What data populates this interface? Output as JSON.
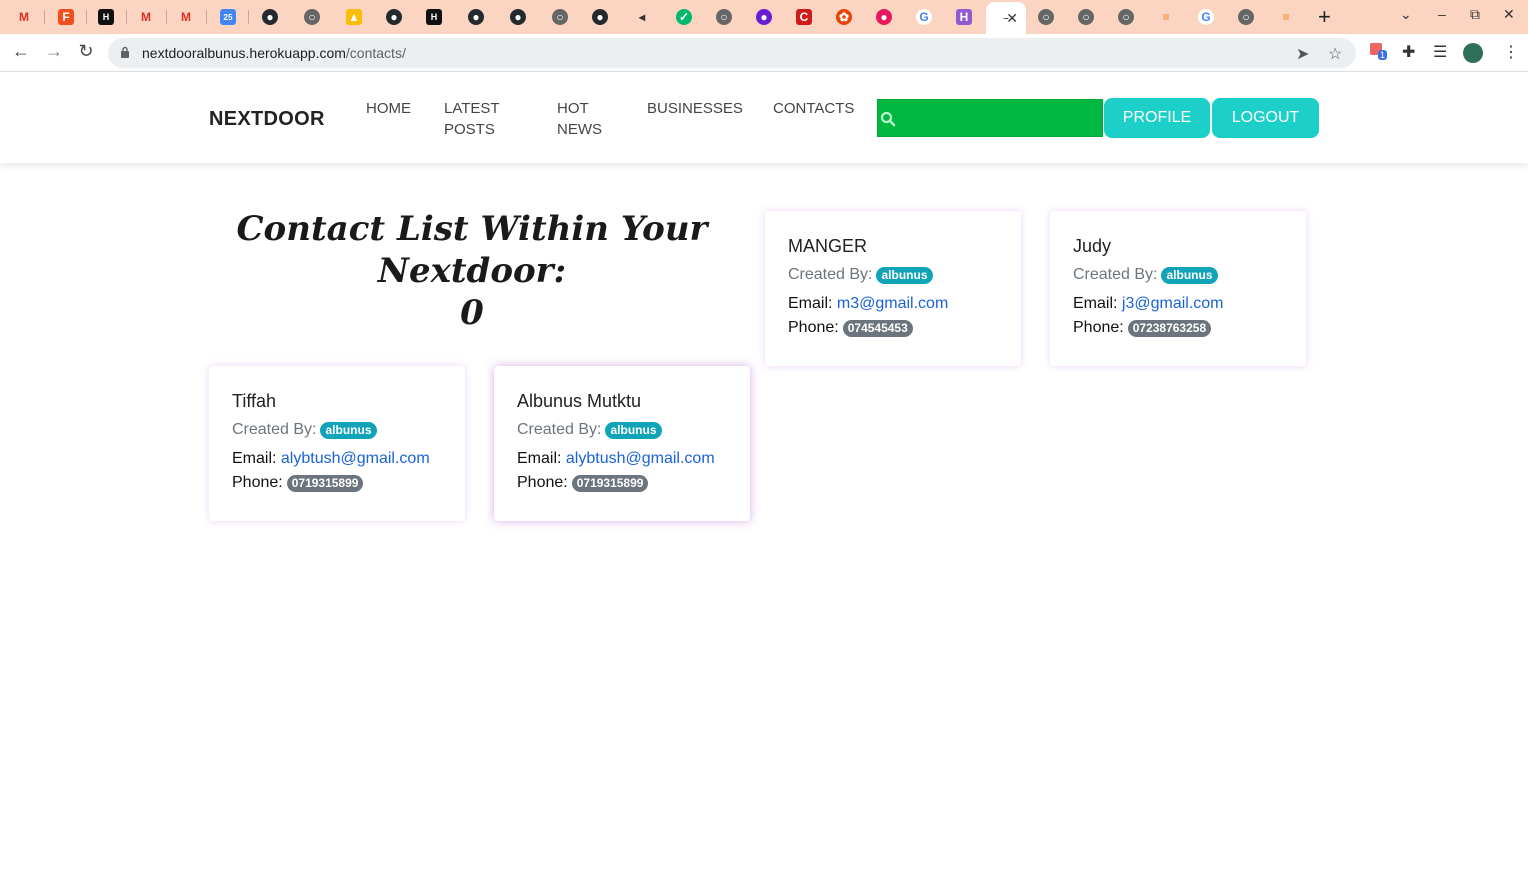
{
  "browser": {
    "url_host": "nextdooralbunus.herokuapp.com",
    "url_path": "/contacts/",
    "extension_badge": "1"
  },
  "site": {
    "brand": "NEXTDOOR",
    "nav": {
      "home": "HOME",
      "latest_posts_1": "LATEST",
      "latest_posts_2": "POSTS",
      "hot_news_1": "HOT",
      "hot_news_2": "NEWS",
      "businesses": "BUSINESSES",
      "contacts": "CONTACTS"
    },
    "search": {
      "value": "",
      "placeholder": ""
    },
    "profile_label": "PROFILE",
    "logout_label": "LOGOUT"
  },
  "page": {
    "heading_line1": "Contact List Within Your Nextdoor:",
    "heading_line2": "0"
  },
  "labels": {
    "created_by": "Created By:",
    "email": "Email:",
    "phone": "Phone:"
  },
  "contacts": [
    {
      "name": "MANGER",
      "creator": "albunus",
      "email": "m3@gmail.com",
      "phone": "074545453"
    },
    {
      "name": "Judy",
      "creator": "albunus",
      "email": "j3@gmail.com",
      "phone": "07238763258"
    },
    {
      "name": "Tiffah",
      "creator": "albunus",
      "email": "alybtush@gmail.com",
      "phone": "0719315899"
    },
    {
      "name": "Albunus Mutktu",
      "creator": "albunus",
      "email": "alybtush@gmail.com",
      "phone": "0719315899"
    }
  ],
  "colors": {
    "tab_strip": "#fcd4c2",
    "search_green": "#00b840",
    "button_teal": "#1ccfc9",
    "creator_badge": "#11a3b8",
    "phone_badge": "#6c757d",
    "link_blue": "#1a62d8"
  },
  "icons": {
    "search": "magnifier-icon",
    "back": "arrow-left-icon",
    "forward": "arrow-right-icon",
    "reload": "reload-icon",
    "lock": "lock-icon",
    "share": "send-icon",
    "bookmark": "star-icon",
    "extensions": "puzzle-icon",
    "media": "playlist-icon",
    "menu": "kebab-icon"
  }
}
